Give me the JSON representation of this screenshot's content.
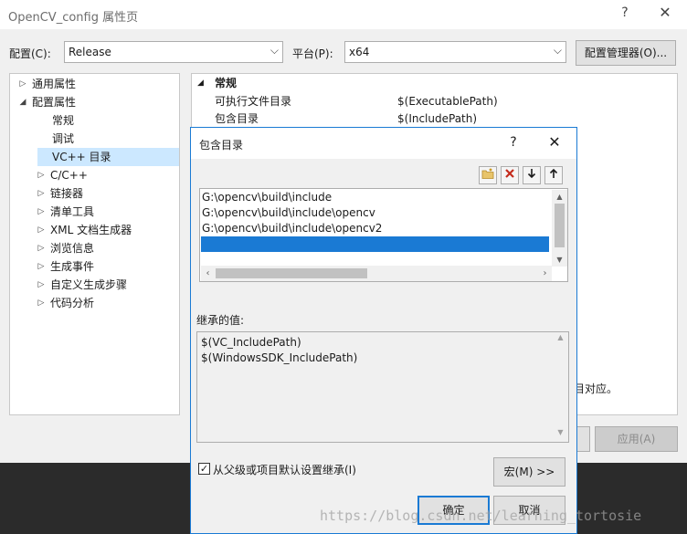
{
  "window": {
    "title": "OpenCV_config 属性页",
    "help": "?",
    "close": "✕"
  },
  "toolbar": {
    "config_label": "配置(C):",
    "config_value": "Release",
    "platform_label": "平台(P):",
    "platform_value": "x64",
    "config_manager_label": "配置管理器(O)..."
  },
  "tree": {
    "items": [
      {
        "label": "通用属性",
        "expander": "▷"
      },
      {
        "label": "配置属性",
        "expander": "◢"
      },
      {
        "label": "常规",
        "expander": ""
      },
      {
        "label": "调试",
        "expander": ""
      },
      {
        "label": "VC++ 目录",
        "expander": ""
      },
      {
        "label": "C/C++",
        "expander": "▷"
      },
      {
        "label": "链接器",
        "expander": "▷"
      },
      {
        "label": "清单工具",
        "expander": "▷"
      },
      {
        "label": "XML 文档生成器",
        "expander": "▷"
      },
      {
        "label": "浏览信息",
        "expander": "▷"
      },
      {
        "label": "生成事件",
        "expander": "▷"
      },
      {
        "label": "自定义生成步骤",
        "expander": "▷"
      },
      {
        "label": "代码分析",
        "expander": "▷"
      }
    ]
  },
  "grid": {
    "section_label": "常规",
    "section_expander": "◢",
    "rows": [
      {
        "name": "可执行文件目录",
        "value": "$(ExecutablePath)"
      },
      {
        "name": "包含目录",
        "value": "$(IncludePath)"
      }
    ],
    "description_fragment": "目对应。"
  },
  "outer_buttons": {
    "apply_label": "应用(A)"
  },
  "dialog": {
    "title": "包含目录",
    "help": "?",
    "close": "✕",
    "toolbar_icons": [
      "new-folder-icon",
      "delete-icon",
      "move-down-icon",
      "move-up-icon"
    ],
    "list_items": [
      "G:\\opencv\\build\\include",
      "G:\\opencv\\build\\include\\opencv",
      "G:\\opencv\\build\\include\\opencv2",
      ""
    ],
    "inherited_label": "继承的值:",
    "inherited_values": [
      "$(VC_IncludePath)",
      "$(WindowsSDK_IncludePath)"
    ],
    "inherit_checkbox_label": "从父级或项目默认设置继承(I)",
    "inherit_checked": true,
    "macro_button_label": "宏(M) >>",
    "ok_label": "确定",
    "cancel_label": "取消"
  },
  "watermark": "https://blog.csdn.net/learning_tortosie",
  "colors": {
    "accent": "#1a7ad4",
    "selection": "#cce8ff"
  }
}
